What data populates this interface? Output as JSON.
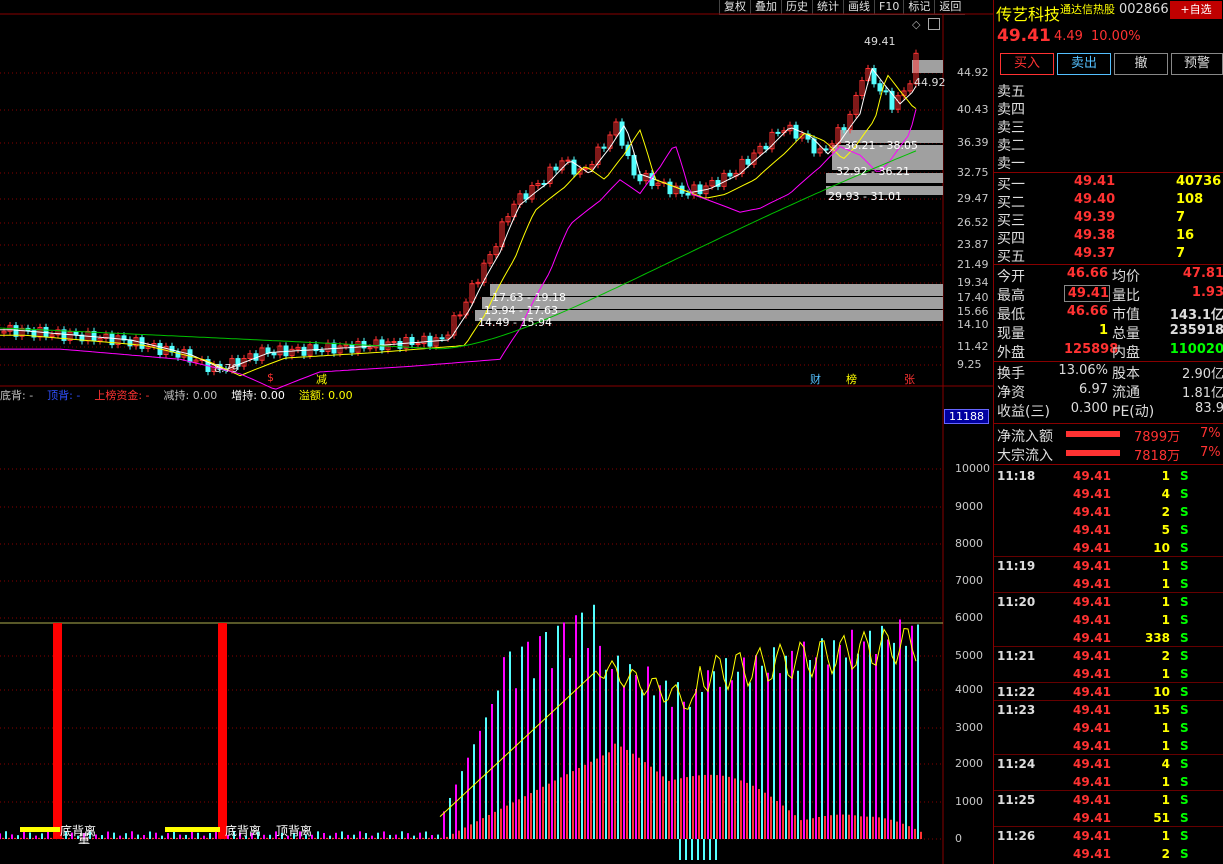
{
  "toolbar": [
    "复权",
    "叠加",
    "历史",
    "统计",
    "画线",
    "F10",
    "标记",
    "返回"
  ],
  "price_axis": [
    "44.92",
    "40.43",
    "36.39",
    "32.75",
    "29.47",
    "26.52",
    "23.87",
    "21.49",
    "19.34",
    "17.40",
    "15.66",
    "14.10",
    "11.42",
    "9.25"
  ],
  "chart_annotations": {
    "high": "49.41",
    "prev": "44.92",
    "low": "8.79",
    "zones": [
      "36.21 - 38.05",
      "32.92 - 36.21",
      "29.93 - 31.01",
      "17.63 - 19.18",
      "15.94 - 17.63",
      "14.49 - 15.94"
    ],
    "events": [
      "$",
      "减",
      "财",
      "榜",
      "张"
    ]
  },
  "indicator_bar": {
    "items": [
      "底背: -",
      "顶背: -",
      "上榜资金: -",
      "减持: 0.00",
      "增持: 0.00",
      "溢额: 0.00"
    ]
  },
  "indicator_axis": [
    "11188",
    "10000",
    "9000",
    "8000",
    "7000",
    "6000",
    "5000",
    "4000",
    "3000",
    "2000",
    "1000",
    "0"
  ],
  "indicator_labels": [
    "底背离",
    "底背离",
    "顶背离",
    "量"
  ],
  "panel": {
    "name": "传艺科技",
    "tag": "通达信热股",
    "code": "002866",
    "add_btn": "+自选",
    "price": "49.41",
    "change": "4.49",
    "change_pct": "10.00%",
    "buttons": [
      "买入",
      "卖出",
      "撤",
      "预警"
    ],
    "sells": [
      "卖五",
      "卖四",
      "卖三",
      "卖二",
      "卖一"
    ],
    "buys": [
      {
        "label": "买一",
        "price": "49.41",
        "vol": "40736"
      },
      {
        "label": "买二",
        "price": "49.40",
        "vol": "108"
      },
      {
        "label": "买三",
        "price": "49.39",
        "vol": "7"
      },
      {
        "label": "买四",
        "price": "49.38",
        "vol": "16"
      },
      {
        "label": "买五",
        "price": "49.37",
        "vol": "7"
      }
    ],
    "stats": [
      {
        "l1": "今开",
        "v1": "46.66",
        "l2": "均价",
        "v2": "47.81"
      },
      {
        "l1": "最高",
        "v1": "49.41",
        "l2": "量比",
        "v2": "1.93"
      },
      {
        "l1": "最低",
        "v1": "46.66",
        "l2": "市值",
        "v2": "143.1亿"
      },
      {
        "l1": "现量",
        "v1": "1",
        "l2": "总量",
        "v2": "235918"
      },
      {
        "l1": "外盘",
        "v1": "125898",
        "l2": "内盘",
        "v2": "110020"
      }
    ],
    "stats2": [
      {
        "l1": "换手",
        "v1": "13.06%",
        "l2": "股本",
        "v2": "2.90亿"
      },
      {
        "l1": "净资",
        "v1": "6.97",
        "l2": "流通",
        "v2": "1.81亿"
      },
      {
        "l1": "收益(三)",
        "v1": "0.300",
        "l2": "PE(动)",
        "v2": "83.9"
      }
    ],
    "flows": [
      {
        "label": "净流入额",
        "value": "7899万",
        "pct": "7%"
      },
      {
        "label": "大宗流入",
        "value": "7818万",
        "pct": "7%"
      }
    ],
    "ticks": [
      {
        "t": "11:18",
        "p": "49.41",
        "v": "1",
        "s": "S"
      },
      {
        "t": "",
        "p": "49.41",
        "v": "4",
        "s": "S"
      },
      {
        "t": "",
        "p": "49.41",
        "v": "2",
        "s": "S"
      },
      {
        "t": "",
        "p": "49.41",
        "v": "5",
        "s": "S"
      },
      {
        "t": "",
        "p": "49.41",
        "v": "10",
        "s": "S"
      },
      {
        "t": "11:19",
        "p": "49.41",
        "v": "1",
        "s": "S"
      },
      {
        "t": "",
        "p": "49.41",
        "v": "1",
        "s": "S"
      },
      {
        "t": "11:20",
        "p": "49.41",
        "v": "1",
        "s": "S"
      },
      {
        "t": "",
        "p": "49.41",
        "v": "1",
        "s": "S"
      },
      {
        "t": "",
        "p": "49.41",
        "v": "338",
        "s": "S"
      },
      {
        "t": "11:21",
        "p": "49.41",
        "v": "2",
        "s": "S"
      },
      {
        "t": "",
        "p": "49.41",
        "v": "1",
        "s": "S"
      },
      {
        "t": "11:22",
        "p": "49.41",
        "v": "10",
        "s": "S"
      },
      {
        "t": "11:23",
        "p": "49.41",
        "v": "15",
        "s": "S"
      },
      {
        "t": "",
        "p": "49.41",
        "v": "1",
        "s": "S"
      },
      {
        "t": "",
        "p": "49.41",
        "v": "1",
        "s": "S"
      },
      {
        "t": "11:24",
        "p": "49.41",
        "v": "4",
        "s": "S"
      },
      {
        "t": "",
        "p": "49.41",
        "v": "1",
        "s": "S"
      },
      {
        "t": "11:25",
        "p": "49.41",
        "v": "1",
        "s": "S"
      },
      {
        "t": "",
        "p": "49.41",
        "v": "51",
        "s": "S"
      },
      {
        "t": "11:26",
        "p": "49.41",
        "v": "1",
        "s": "S"
      },
      {
        "t": "",
        "p": "49.41",
        "v": "2",
        "s": "S"
      }
    ]
  },
  "colors": {
    "up": "#ff3232",
    "down": "#54ffff",
    "ma5": "#ffffff",
    "ma10": "#ffff00",
    "ma20": "#ff00ff",
    "ma60": "#00c000"
  }
}
